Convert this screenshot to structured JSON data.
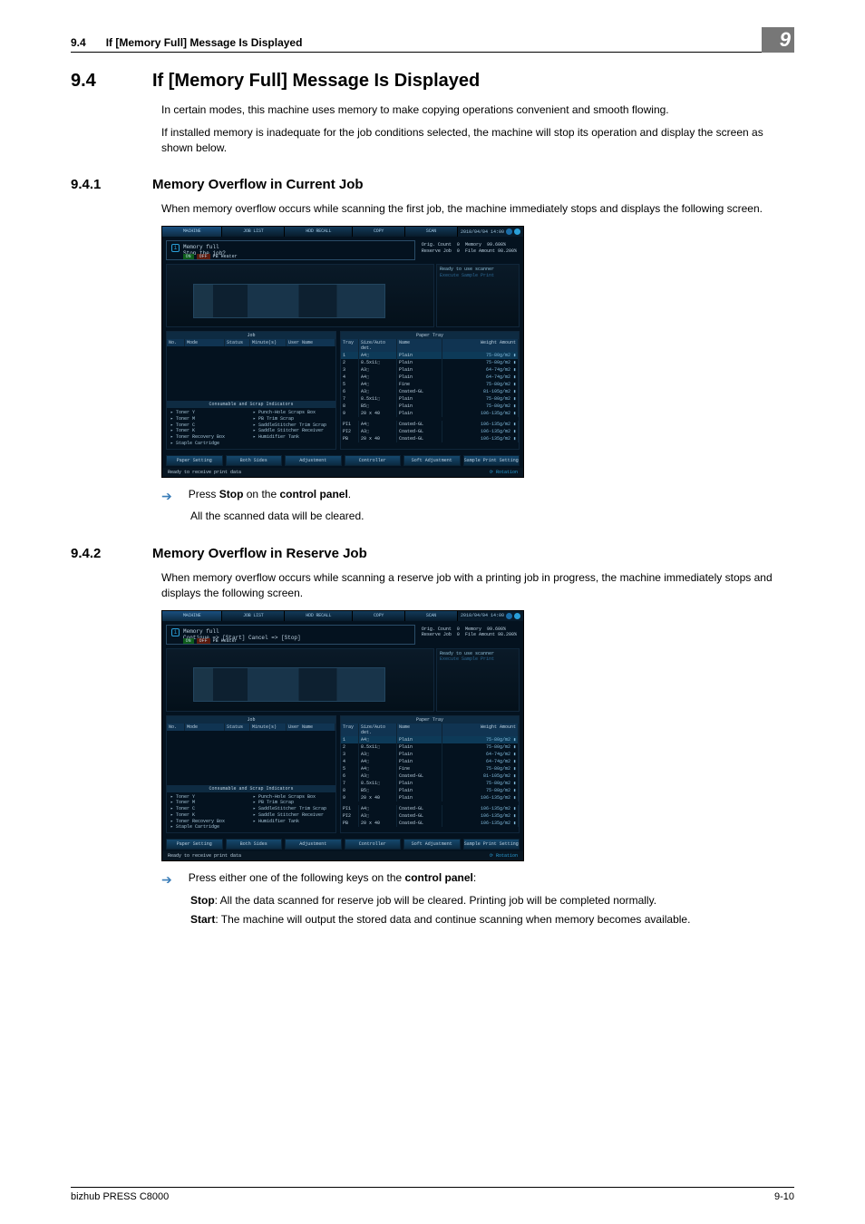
{
  "header": {
    "section_no": "9.4",
    "section_title": "If [Memory Full] Message Is Displayed",
    "chapter_no": "9"
  },
  "h1": {
    "no": "9.4",
    "title": "If [Memory Full] Message Is Displayed"
  },
  "intro1": "In certain modes, this machine uses memory to make copying operations convenient and smooth flowing.",
  "intro2": "If installed memory is inadequate for the job conditions selected, the machine will stop its operation and display the screen as shown below.",
  "s941": {
    "no": "9.4.1",
    "title": "Memory Overflow in Current Job",
    "para": "When memory overflow occurs while scanning the first job, the machine immediately stops and displays the following screen.",
    "bullet_pre": "Press ",
    "bullet_b1": "Stop",
    "bullet_mid": " on the ",
    "bullet_b2": "control panel",
    "bullet_post": ".",
    "follow": "All the scanned data will be cleared."
  },
  "s942": {
    "no": "9.4.2",
    "title": "Memory Overflow in Reserve Job",
    "para": "When memory overflow occurs while scanning a reserve job with a printing job in progress, the machine immediately stops and displays the following screen.",
    "bullet_pre": "Press either one of the following keys on the ",
    "bullet_b1": "control panel",
    "bullet_post": ":",
    "stop_b": "Stop",
    "stop_t": ": All the data scanned for reserve job will be cleared. Printing job will be completed normally.",
    "start_b": "Start",
    "start_t": ": The machine will output the stored data and continue scanning when memory becomes available."
  },
  "panel": {
    "tabs": [
      "MACHINE",
      "JOB LIST",
      "HDD RECALL",
      "COPY",
      "SCAN"
    ],
    "datetime": "2010/04/04 14:00",
    "msg1_l1": "Memory full",
    "msg1_l2": "Stop the job?",
    "msg2_l1": "Memory full",
    "msg2_l2": "Continue => [Start]   Cancel => [Stop]",
    "counters": {
      "r1l": "Orig. Count",
      "r1v1": "0",
      "r1r": "Memory",
      "r1v2": "99.600%",
      "r2l": "Reserve Job",
      "r2v1": "0",
      "r2r": "File Amount",
      "r2v2": "98.200%"
    },
    "heater_on": "ON",
    "heater_off": "OFF",
    "heater_label": "PB Heater",
    "ready": "Ready to use scanner",
    "exec": "Execute Sample Print",
    "job_h": "Job",
    "job_cols": {
      "no": "No.",
      "mode": "Mode",
      "status": "Status",
      "minute": "Minute(s)",
      "user": "User Name"
    },
    "tray_h": "Paper Tray",
    "tray_cols": {
      "tray": "Tray",
      "size": "Size/Auto det.",
      "name": "Name",
      "weight": "Weight  Amount"
    },
    "trays_a": [
      {
        "t": "1",
        "s": "A4⬚",
        "n": "Plain",
        "w": "75-80g/m2"
      },
      {
        "t": "2",
        "s": "8.5x11⬚",
        "n": "Plain",
        "w": "75-80g/m2"
      },
      {
        "t": "3",
        "s": "A3⬚",
        "n": "Plain",
        "w": "64-74g/m2"
      },
      {
        "t": "4",
        "s": "A4⬚",
        "n": "Plain",
        "w": "64-74g/m2"
      },
      {
        "t": "5",
        "s": "A4⬚",
        "n": "Fine",
        "w": "75-80g/m2"
      },
      {
        "t": "6",
        "s": "A3⬚",
        "n": "Coated-GL",
        "w": "81-105g/m2"
      },
      {
        "t": "7",
        "s": "8.5x11⬚",
        "n": "Plain",
        "w": "75-80g/m2"
      },
      {
        "t": "8",
        "s": "B5⬚",
        "n": "Plain",
        "w": "75-80g/m2"
      },
      {
        "t": "9",
        "s": "20 x 40",
        "n": "Plain",
        "w": "106-135g/m2"
      }
    ],
    "trays_pi": [
      {
        "t": "PI1",
        "s": "A4⬚",
        "n": "Coated-GL",
        "w": "106-135g/m2"
      },
      {
        "t": "PI2",
        "s": "A3⬚",
        "n": "Coated-GL",
        "w": "106-135g/m2"
      },
      {
        "t": "PB",
        "s": "20 x 40",
        "n": "Coated-GL",
        "w": "106-135g/m2"
      }
    ],
    "consum_h": "Consumable and Scrap Indicators",
    "consum_items": [
      "Toner Y",
      "Toner M",
      "Toner C",
      "Toner K",
      "Toner Recovery Box",
      "Staple Cartridge",
      "Punch-Hole Scraps Box",
      "PB Trim Scrap",
      "SaddleStitcher Trim Scrap",
      "Saddle Stitcher Receiver",
      "Humidifier Tank"
    ],
    "btns": [
      "Paper Setting",
      "Both Sides",
      "Adjustment",
      "Controller",
      "Soft Adjustment",
      "Sample Print Setting"
    ],
    "foot_l": "Ready to receive print data",
    "foot_r": "Rotation"
  },
  "footer": {
    "left": "bizhub PRESS C8000",
    "right": "9-10"
  }
}
